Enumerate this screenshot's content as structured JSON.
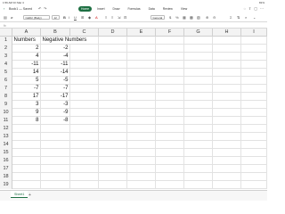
{
  "status": {
    "time": "1:56 AM  Fri Mar 4",
    "battery": "81%"
  },
  "title": {
    "back": "‹",
    "file_name": "Book1 — Saved"
  },
  "tabs": [
    {
      "label": "Home",
      "active": true
    },
    {
      "label": "Insert"
    },
    {
      "label": "Draw"
    },
    {
      "label": "Formulas"
    },
    {
      "label": "Data"
    },
    {
      "label": "Review"
    },
    {
      "label": "View"
    }
  ],
  "ribbon": {
    "font_name": "Calibri (Body)",
    "font_size": "12",
    "number_format": "General"
  },
  "formula_bar": {
    "fx": "fx"
  },
  "columns": [
    "A",
    "B",
    "C",
    "D",
    "E",
    "F",
    "G",
    "H",
    "I"
  ],
  "rows": [
    {
      "n": "1",
      "a": "Numbers",
      "b": "Negative Numbers"
    },
    {
      "n": "2",
      "a": "2",
      "b": "-2"
    },
    {
      "n": "3",
      "a": "4",
      "b": "-4"
    },
    {
      "n": "4",
      "a": "-11",
      "b": "-11"
    },
    {
      "n": "5",
      "a": "14",
      "b": "-14"
    },
    {
      "n": "6",
      "a": "5",
      "b": "-5"
    },
    {
      "n": "7",
      "a": "-7",
      "b": "-7"
    },
    {
      "n": "8",
      "a": "17",
      "b": "-17"
    },
    {
      "n": "9",
      "a": "3",
      "b": "-3"
    },
    {
      "n": "10",
      "a": "9",
      "b": "-9"
    },
    {
      "n": "11",
      "a": "8",
      "b": "-8"
    },
    {
      "n": "12",
      "a": "",
      "b": ""
    },
    {
      "n": "13",
      "a": "",
      "b": ""
    },
    {
      "n": "14",
      "a": "",
      "b": ""
    },
    {
      "n": "15",
      "a": "",
      "b": ""
    },
    {
      "n": "16",
      "a": "",
      "b": ""
    },
    {
      "n": "17",
      "a": "",
      "b": ""
    },
    {
      "n": "18",
      "a": "",
      "b": ""
    },
    {
      "n": "19",
      "a": "",
      "b": ""
    }
  ],
  "sheet": {
    "name": "Sheet1",
    "add": "+"
  },
  "colors": {
    "accent": "#1d6f42"
  }
}
